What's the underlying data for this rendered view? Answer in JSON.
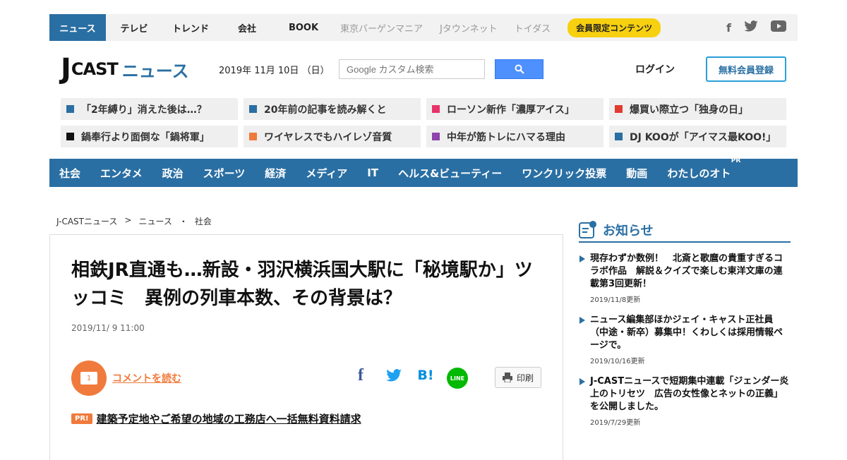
{
  "topbar": {
    "items": [
      {
        "label": "ニュース"
      },
      {
        "label": "テレビ"
      },
      {
        "label": "トレンド"
      },
      {
        "label": "会社"
      },
      {
        "label": "BOOK"
      },
      {
        "label": "東京バーゲンマニア"
      },
      {
        "label": "Jタウンネット"
      },
      {
        "label": "トイダス"
      }
    ],
    "member_badge": "会員限定コンテンツ",
    "social": {
      "facebook": "f",
      "twitter_icon": "twitter-icon",
      "youtube_icon": "youtube-icon"
    }
  },
  "header": {
    "logo_j": "J",
    "logo_cast": "CAST",
    "logo_news": "ニュース",
    "date": "2019年 11月 10日 （日）",
    "search_placeholder": "Google カスタム検索",
    "login": "ログイン",
    "register": "無料会員登録"
  },
  "topics": [
    {
      "label": "「2年縛り」消えた後は…？",
      "color": "#2a6fa3"
    },
    {
      "label": "20年前の記事を読み解くと",
      "color": "#2a6fa3"
    },
    {
      "label": "ローソン新作「濃厚アイス」",
      "color": "#e8336a"
    },
    {
      "label": "爆買い際立つ「独身の日」",
      "color": "#e23b2e"
    },
    {
      "label": "鍋奉行より面倒な「鍋将軍」",
      "color": "#111111"
    },
    {
      "label": "ワイヤレスでもハイレゾ音質",
      "color": "#f07a3c"
    },
    {
      "label": "中年が筋トレにハマる理由",
      "color": "#8e44ad"
    },
    {
      "label": "DJ KOOが「アイマス最KOO!」",
      "color": "#2a6fa3"
    }
  ],
  "categories": [
    {
      "label": "社会"
    },
    {
      "label": "エンタメ"
    },
    {
      "label": "政治"
    },
    {
      "label": "スポーツ"
    },
    {
      "label": "経済"
    },
    {
      "label": "メディア"
    },
    {
      "label": "IT"
    },
    {
      "label": "ヘルス&ビューティー"
    },
    {
      "label": "ワンクリック投票"
    },
    {
      "label": "動画"
    },
    {
      "label": "わたしのオト",
      "sup": "PR"
    }
  ],
  "breadcrumb": [
    "J-CASTニュース",
    ">",
    "ニュース",
    "・",
    "社会"
  ],
  "article": {
    "title": "相鉄JR直通も…新設・羽沢横浜国大駅に「秘境駅か」ツッコミ　異例の列車本数、その背景は？",
    "date": "2019/11/ 9 11:00",
    "comment_count": "1",
    "comment_link": "コメントを読む",
    "share": {
      "facebook": "f",
      "hatena": "B!",
      "line": "LINE"
    },
    "print": "印刷",
    "pr_tag": "PR!",
    "pr_link": "建築予定地やご希望の地域の工務店へ一括無料資料請求"
  },
  "sidebar": {
    "title": "お知らせ",
    "notices": [
      {
        "text": "現存わずか数例！　北斎と歌麿の貴重すぎるコラボ作品　解説＆クイズで楽しむ東洋文庫の連載第3回更新！",
        "date": "2019/11/8更新"
      },
      {
        "text": "ニュース編集部ほかジェイ・キャスト正社員（中途・新卒）募集中！くわしくは採用情報ページで。",
        "date": "2019/10/16更新"
      },
      {
        "text": "J-CASTニュースで短期集中連載「ジェンダー炎上のトリセツ　広告の女性像とネットの正義」を公開しました。",
        "date": "2019/7/29更新"
      }
    ]
  },
  "colors": {
    "brand_blue": "#2a6fa3",
    "accent_orange": "#f07a3c",
    "member_yellow": "#f7d010"
  }
}
